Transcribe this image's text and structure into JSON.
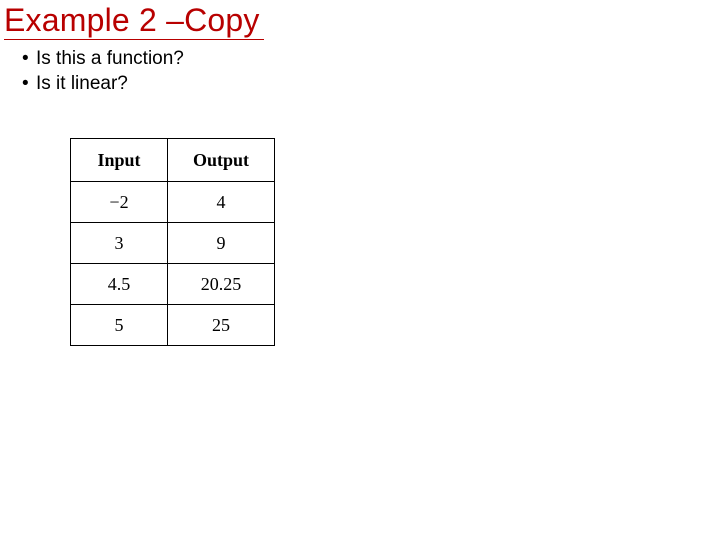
{
  "title": "Example 2 –Copy",
  "bullets": [
    "Is this a function?",
    "Is it linear?"
  ],
  "table": {
    "headers": {
      "input": "Input",
      "output": "Output"
    },
    "rows": [
      {
        "input": "−2",
        "output": "4"
      },
      {
        "input": "3",
        "output": "9"
      },
      {
        "input": "4.5",
        "output": "20.25"
      },
      {
        "input": "5",
        "output": "25"
      }
    ]
  }
}
